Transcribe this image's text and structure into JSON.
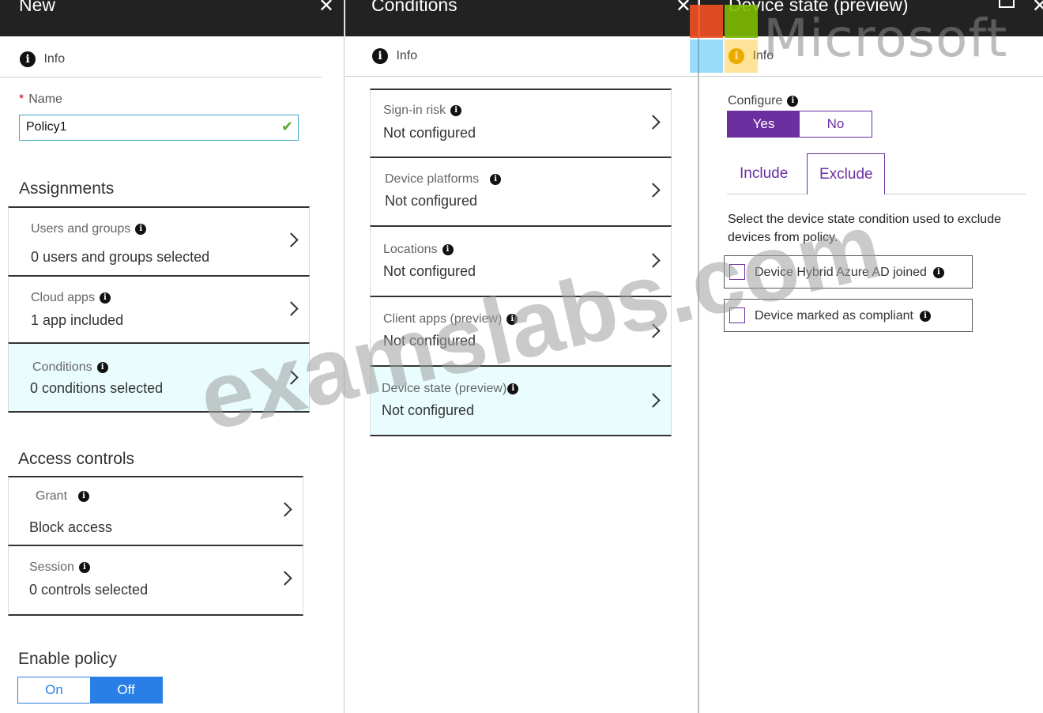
{
  "blade_new": {
    "title": "New",
    "info_label": "Info",
    "name_label": "Name",
    "name_value": "Policy1",
    "assignments_heading": "Assignments",
    "assignments": [
      {
        "label": "Users and groups",
        "value": "0 users and groups selected"
      },
      {
        "label": "Cloud apps",
        "value": "1 app included"
      },
      {
        "label": "Conditions",
        "value": "0  conditions  selected"
      }
    ],
    "access_controls_heading": "Access controls",
    "access_controls": [
      {
        "label": "Grant",
        "value": "Block access"
      },
      {
        "label": "Session",
        "value": "0 controls selected"
      }
    ],
    "enable_policy_heading": "Enable policy",
    "enable_policy_options": [
      "On",
      "Off"
    ],
    "enable_policy_selected": "Off"
  },
  "blade_conditions": {
    "title": "Conditions",
    "info_label": "Info",
    "items": [
      {
        "label": "Sign-in risk",
        "value": "Not configured"
      },
      {
        "label": "Device platforms",
        "value": "Not configured"
      },
      {
        "label": "Locations",
        "value": "Not configured"
      },
      {
        "label": "Client apps (preview)",
        "value": "Not configured"
      },
      {
        "label": "Device state (preview)",
        "value": "Not configured"
      }
    ]
  },
  "blade_device_state": {
    "title": "Device state (preview)",
    "info_label": "Info",
    "configure_label": "Configure",
    "configure_options": [
      "Yes",
      "No"
    ],
    "configure_selected": "Yes",
    "tabs": [
      "Include",
      "Exclude"
    ],
    "active_tab": "Exclude",
    "description": "Select the device state condition used to exclude devices from policy.",
    "checkboxes": [
      {
        "label": "Device Hybrid Azure AD joined",
        "checked": false
      },
      {
        "label": "Device marked as compliant",
        "checked": false
      }
    ]
  },
  "overlay": {
    "logo_text": "Microsoft",
    "watermark_text": "examslabs.com"
  },
  "colors": {
    "titlebar": "#222222",
    "accent_blue": "#2a7fe6",
    "accent_purple": "#6b2fa0",
    "selected_row": "#e9fdff",
    "ms_red": "#f25022",
    "ms_green": "#7fba00",
    "ms_blue": "#00a4ef",
    "ms_yellow": "#ffb900"
  }
}
